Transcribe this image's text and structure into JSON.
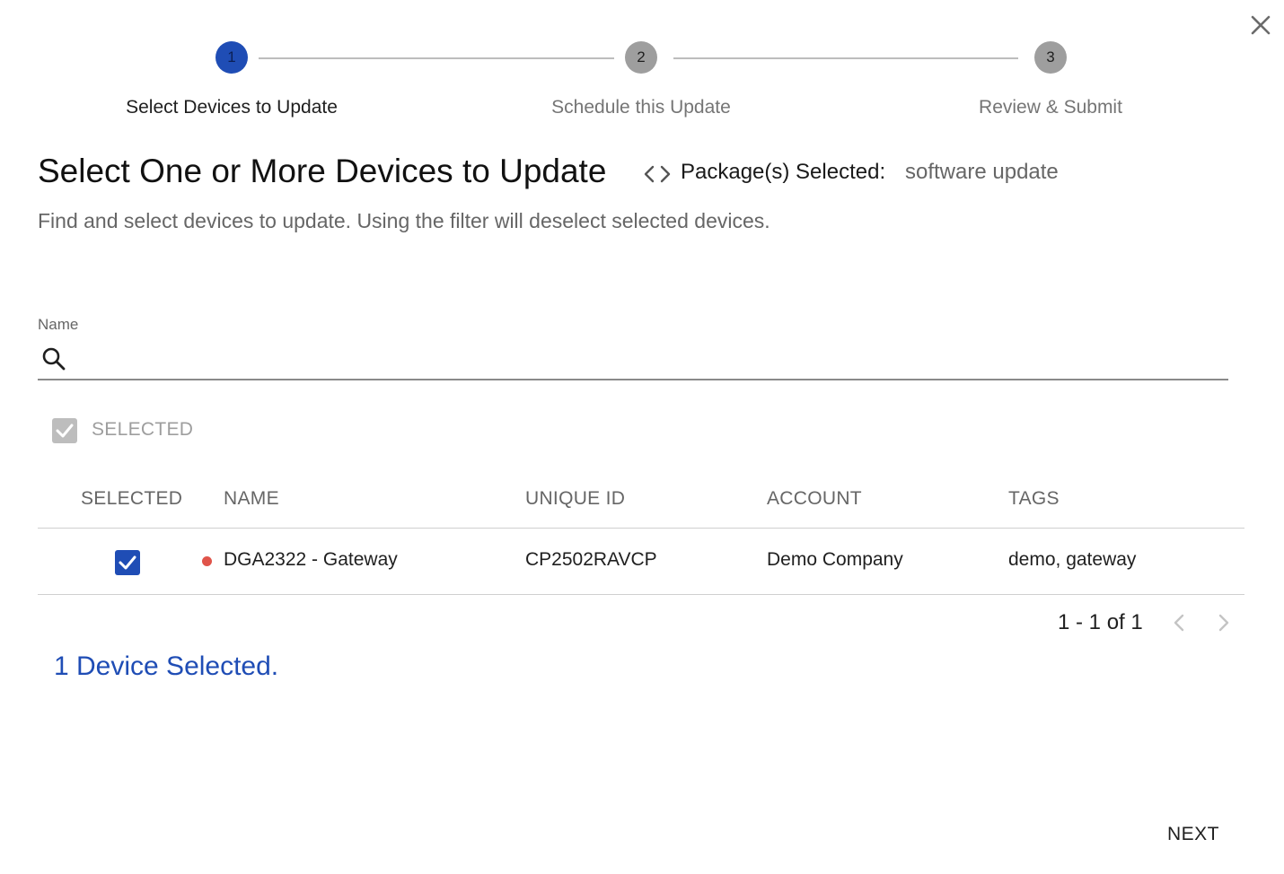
{
  "stepper": {
    "steps": [
      {
        "number": "1",
        "label": "Select Devices to Update",
        "state": "active"
      },
      {
        "number": "2",
        "label": "Schedule this Update",
        "state": "inactive"
      },
      {
        "number": "3",
        "label": "Review & Submit",
        "state": "inactive"
      }
    ]
  },
  "header": {
    "title": "Select One or More Devices to Update",
    "package_label": "Package(s) Selected:",
    "package_value": "software update",
    "subtitle": "Find and select devices to update. Using the filter will deselect selected devices."
  },
  "search": {
    "label": "Name",
    "value": "",
    "placeholder": ""
  },
  "filter": {
    "label": "SELECTED",
    "checked": true
  },
  "table": {
    "columns": [
      "SELECTED",
      "NAME",
      "UNIQUE ID",
      "ACCOUNT",
      "TAGS"
    ],
    "rows": [
      {
        "selected": true,
        "status": "offline",
        "name": "DGA2322 - Gateway",
        "unique_id": "CP2502RAVCP",
        "account": "Demo Company",
        "tags": "demo, gateway"
      }
    ]
  },
  "pagination": {
    "range": "1 - 1 of 1"
  },
  "selection_summary": "1 Device Selected.",
  "actions": {
    "next_label": "NEXT"
  },
  "colors": {
    "accent": "#1f4db5",
    "status_dot": "#e0544a",
    "muted_text": "#666666"
  },
  "icons": {
    "close": "close-icon",
    "code": "code-icon",
    "search": "search-icon",
    "check": "check-icon",
    "prev": "chevron-left-icon",
    "next": "chevron-right-icon"
  }
}
